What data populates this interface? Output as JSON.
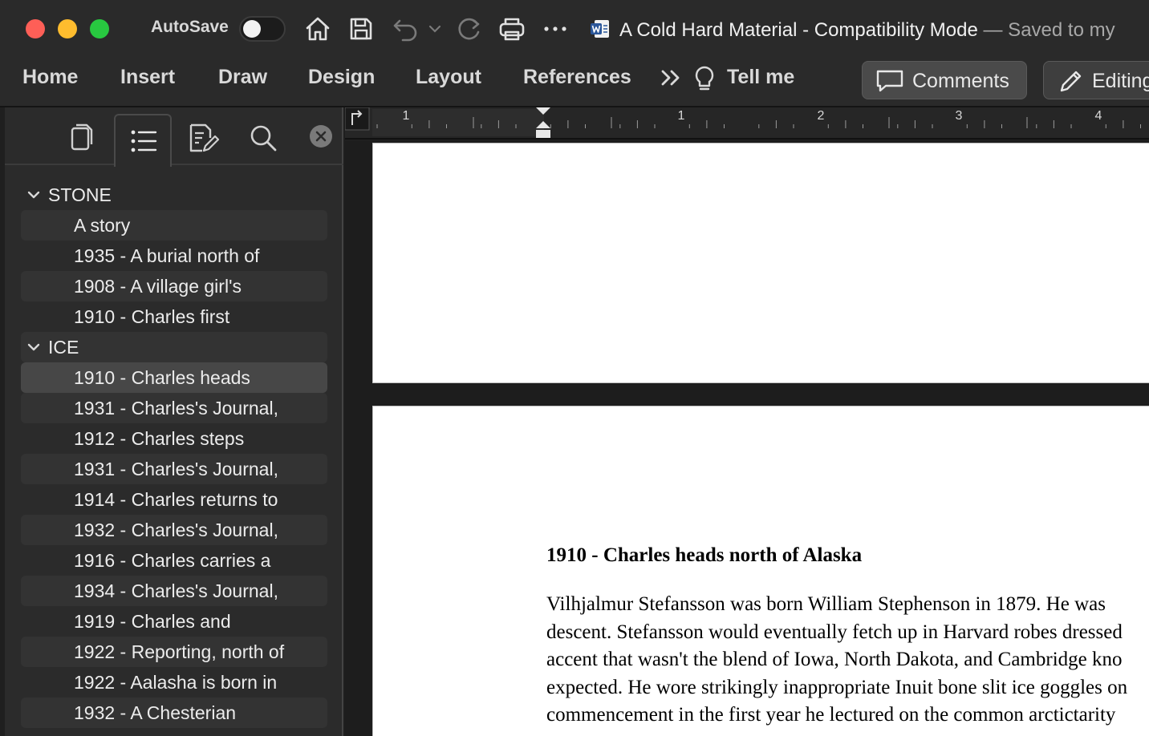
{
  "titlebar": {
    "autosave_label": "AutoSave",
    "doc_title": "A Cold Hard Material  -  Compatibility Mode",
    "saved_status": " — Saved to my"
  },
  "ribbon": {
    "tabs": [
      "Home",
      "Insert",
      "Draw",
      "Design",
      "Layout",
      "References"
    ],
    "tell_me": "Tell me",
    "comments_label": "Comments",
    "editing_label": "Editing"
  },
  "ruler": {
    "labels": [
      "1",
      "1",
      "2",
      "3",
      "4"
    ]
  },
  "nav": {
    "rows": [
      {
        "type": "heading",
        "label": "STONE"
      },
      {
        "type": "item",
        "label": "A story"
      },
      {
        "type": "item",
        "label": "1935 - A burial north of"
      },
      {
        "type": "item",
        "label": "1908 - A village girl's"
      },
      {
        "type": "item",
        "label": "1910 - Charles first"
      },
      {
        "type": "heading",
        "label": "ICE"
      },
      {
        "type": "item",
        "label": "1910 - Charles heads",
        "selected": true
      },
      {
        "type": "item",
        "label": "1931 - Charles's Journal,"
      },
      {
        "type": "item",
        "label": "1912 - Charles steps"
      },
      {
        "type": "item",
        "label": "1931 - Charles's Journal,"
      },
      {
        "type": "item",
        "label": "1914 - Charles returns to"
      },
      {
        "type": "item",
        "label": "1932 - Charles's Journal,"
      },
      {
        "type": "item",
        "label": "1916 - Charles carries a"
      },
      {
        "type": "item",
        "label": "1934 - Charles's Journal,"
      },
      {
        "type": "item",
        "label": "1919 - Charles and"
      },
      {
        "type": "item",
        "label": "1922 - Reporting, north of"
      },
      {
        "type": "item",
        "label": "1922 - Aalasha is born in"
      },
      {
        "type": "item",
        "label": "1932 - A Chesterian"
      }
    ]
  },
  "document": {
    "heading": "1910 - Charles heads north of Alaska",
    "lines": [
      "   Vilhjalmur Stefansson was born William Stephenson in 1879. He was",
      "descent. Stefansson would eventually fetch up in Harvard robes dressed",
      "accent that wasn't the blend of Iowa, North Dakota, and Cambridge kno",
      "expected. He wore strikingly inappropriate Inuit bone slit ice goggles on",
      "commencement in the first year he lectured on the common arctictarity"
    ]
  }
}
